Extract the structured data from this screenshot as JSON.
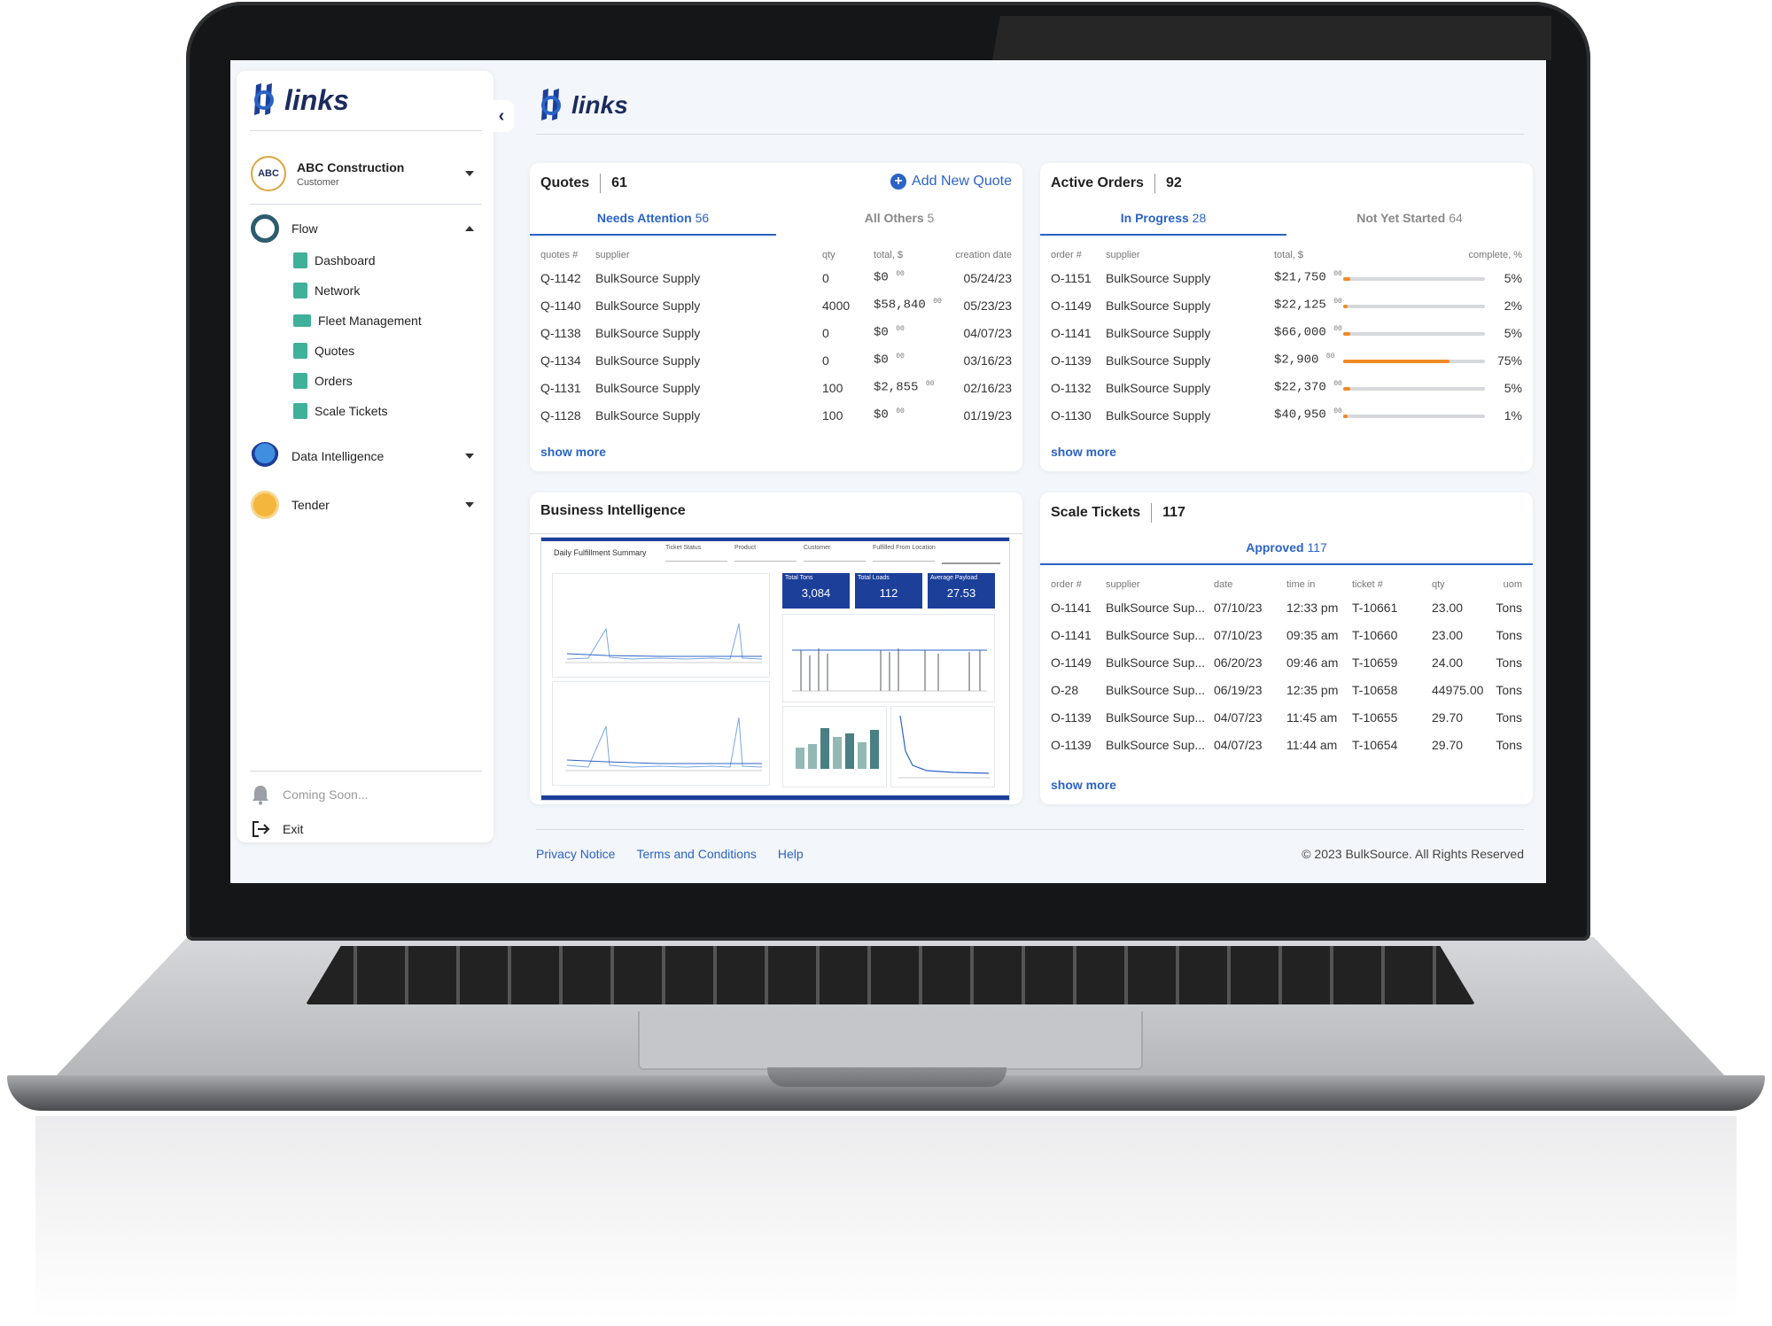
{
  "brand": {
    "name": "links",
    "accent": "#2b63c7",
    "navy": "#1b2b5e"
  },
  "sidebar": {
    "company": {
      "badge": "ABC",
      "name": "ABC Construction",
      "role": "Customer"
    },
    "flow": {
      "label": "Flow",
      "items": [
        {
          "label": "Dashboard",
          "icon": "dashboard-icon"
        },
        {
          "label": "Network",
          "icon": "document-icon"
        },
        {
          "label": "Fleet Management",
          "icon": "truck-icon"
        },
        {
          "label": "Quotes",
          "icon": "document-icon"
        },
        {
          "label": "Orders",
          "icon": "dollar-document-icon"
        },
        {
          "label": "Scale Tickets",
          "icon": "ticket-icon"
        }
      ]
    },
    "data_intelligence": {
      "label": "Data Intelligence"
    },
    "tender": {
      "label": "Tender"
    },
    "coming_soon": "Coming Soon...",
    "exit": "Exit"
  },
  "quotes": {
    "title": "Quotes",
    "count": "61",
    "add_label": "Add New Quote",
    "tabs": [
      {
        "label": "Needs Attention",
        "num": "56"
      },
      {
        "label": "All Others",
        "num": "5"
      }
    ],
    "headers": [
      "quotes #",
      "supplier",
      "qty",
      "total, $",
      "creation date"
    ],
    "rows": [
      {
        "id": "Q-1142",
        "supplier": "BulkSource Supply",
        "qty": "0",
        "total": "$0",
        "cents": "00",
        "date": "05/24/23"
      },
      {
        "id": "Q-1140",
        "supplier": "BulkSource Supply",
        "qty": "4000",
        "total": "$58,840",
        "cents": "00",
        "date": "05/23/23"
      },
      {
        "id": "Q-1138",
        "supplier": "BulkSource Supply",
        "qty": "0",
        "total": "$0",
        "cents": "00",
        "date": "04/07/23"
      },
      {
        "id": "Q-1134",
        "supplier": "BulkSource Supply",
        "qty": "0",
        "total": "$0",
        "cents": "00",
        "date": "03/16/23"
      },
      {
        "id": "Q-1131",
        "supplier": "BulkSource Supply",
        "qty": "100",
        "total": "$2,855",
        "cents": "00",
        "date": "02/16/23"
      },
      {
        "id": "Q-1128",
        "supplier": "BulkSource Supply",
        "qty": "100",
        "total": "$0",
        "cents": "00",
        "date": "01/19/23"
      }
    ],
    "show_more": "show more"
  },
  "orders": {
    "title": "Active Orders",
    "count": "92",
    "tabs": [
      {
        "label": "In Progress",
        "num": "28"
      },
      {
        "label": "Not Yet Started",
        "num": "64"
      }
    ],
    "headers": [
      "order #",
      "supplier",
      "total, $",
      "complete, %"
    ],
    "rows": [
      {
        "id": "O-1151",
        "supplier": "BulkSource Supply",
        "total": "$21,750",
        "cents": "00",
        "pct": "5%",
        "fill": 5
      },
      {
        "id": "O-1149",
        "supplier": "BulkSource Supply",
        "total": "$22,125",
        "cents": "00",
        "pct": "2%",
        "fill": 2
      },
      {
        "id": "O-1141",
        "supplier": "BulkSource Supply",
        "total": "$66,000",
        "cents": "00",
        "pct": "5%",
        "fill": 5
      },
      {
        "id": "O-1139",
        "supplier": "BulkSource Supply",
        "total": "$2,900",
        "cents": "00",
        "pct": "75%",
        "fill": 75
      },
      {
        "id": "O-1132",
        "supplier": "BulkSource Supply",
        "total": "$22,370",
        "cents": "00",
        "pct": "5%",
        "fill": 5
      },
      {
        "id": "O-1130",
        "supplier": "BulkSource Supply",
        "total": "$40,950",
        "cents": "00",
        "pct": "1%",
        "fill": 1
      }
    ],
    "show_more": "show more"
  },
  "bi": {
    "title": "Business Intelligence",
    "report_title": "Daily Fulfillment Summary",
    "filters": [
      "Ticket Status",
      "Product",
      "Customer",
      "Fulfilled From Location"
    ],
    "kpis": [
      {
        "label": "Total Tons",
        "value": "3,084"
      },
      {
        "label": "Total Loads",
        "value": "112"
      },
      {
        "label": "Average Payload",
        "value": "27.53"
      }
    ]
  },
  "tickets": {
    "title": "Scale Tickets",
    "count": "117",
    "tabs": [
      {
        "label": "Approved",
        "num": "117"
      }
    ],
    "headers": [
      "order #",
      "supplier",
      "date",
      "time in",
      "ticket #",
      "qty",
      "uom"
    ],
    "rows": [
      {
        "order": "O-1141",
        "supplier": "BulkSource Sup...",
        "date": "07/10/23",
        "time": "12:33 pm",
        "ticket": "T-10661",
        "qty": "23.00",
        "uom": "Tons"
      },
      {
        "order": "O-1141",
        "supplier": "BulkSource Sup...",
        "date": "07/10/23",
        "time": "09:35 am",
        "ticket": "T-10660",
        "qty": "23.00",
        "uom": "Tons"
      },
      {
        "order": "O-1149",
        "supplier": "BulkSource Sup...",
        "date": "06/20/23",
        "time": "09:46 am",
        "ticket": "T-10659",
        "qty": "24.00",
        "uom": "Tons"
      },
      {
        "order": "O-28",
        "supplier": "BulkSource Sup...",
        "date": "06/19/23",
        "time": "12:35 pm",
        "ticket": "T-10658",
        "qty": "44975.00",
        "uom": "Tons"
      },
      {
        "order": "O-1139",
        "supplier": "BulkSource Sup...",
        "date": "04/07/23",
        "time": "11:45 am",
        "ticket": "T-10655",
        "qty": "29.70",
        "uom": "Tons"
      },
      {
        "order": "O-1139",
        "supplier": "BulkSource Sup...",
        "date": "04/07/23",
        "time": "11:44 am",
        "ticket": "T-10654",
        "qty": "29.70",
        "uom": "Tons"
      }
    ],
    "show_more": "show more"
  },
  "footer": {
    "links": [
      "Privacy Notice",
      "Terms and Conditions",
      "Help"
    ],
    "copyright": "© 2023 BulkSource. All Rights Reserved"
  }
}
